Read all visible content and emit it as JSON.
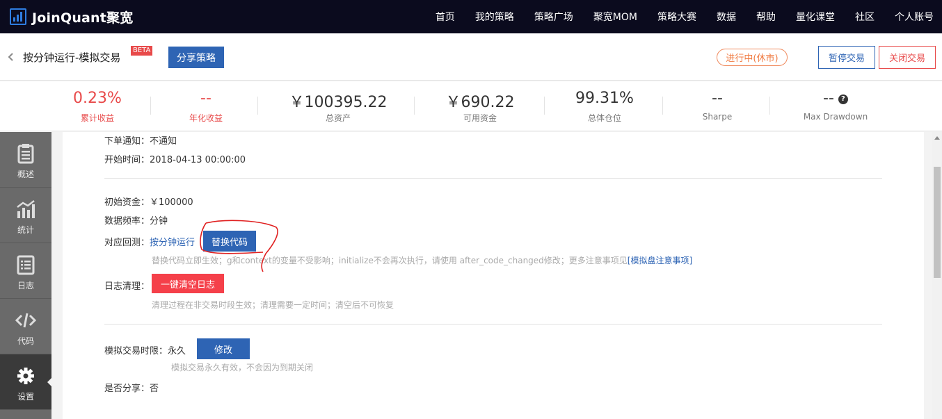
{
  "nav": {
    "brand": "JoinQuant聚宽",
    "items": [
      "首页",
      "我的策略",
      "策略广场",
      "聚宽MOM",
      "策略大赛",
      "数据",
      "帮助",
      "量化课堂",
      "社区",
      "个人账号"
    ]
  },
  "header": {
    "title": "按分钟运行-模拟交易",
    "beta": "BETA",
    "share_label": "分享策略",
    "status": "进行中(休市)",
    "pause_label": "暂停交易",
    "close_label": "关闭交易"
  },
  "stats": [
    {
      "value": "0.23%",
      "label": "累计收益",
      "color": "#e84a4a"
    },
    {
      "value": "--",
      "label": "年化收益",
      "color": "#e84a4a"
    },
    {
      "value": "￥100395.22",
      "label": "总资产"
    },
    {
      "value": "￥690.22",
      "label": "可用资金"
    },
    {
      "value": "99.31%",
      "label": "总体仓位"
    },
    {
      "value": "--",
      "label": "Sharpe"
    },
    {
      "value": "--",
      "label": "Max Drawdown",
      "icon": "help-icon"
    }
  ],
  "sidebar": {
    "items": [
      {
        "label": "概述",
        "icon": "clipboard-icon"
      },
      {
        "label": "统计",
        "icon": "chart-icon"
      },
      {
        "label": "日志",
        "icon": "list-icon"
      },
      {
        "label": "代码",
        "icon": "code-icon"
      },
      {
        "label": "设置",
        "icon": "gear-icon",
        "active": true
      }
    ]
  },
  "settings": {
    "order_notice": "下单通知：不通知",
    "start_time": "开始时间：2018-04-13 00:00:00",
    "initial_capital": "初始资金：￥100000",
    "data_freq": "数据频率：分钟",
    "backtest_label": "对应回测：",
    "backtest_link": "按分钟运行",
    "replace_code_label": "替换代码",
    "replace_hint": "替换代码立即生效；g和context的变量不受影响；initialize不会再次执行，请使用 after_code_changed修改；更多注意事项见",
    "replace_hint_link": "[模拟盘注意事项]",
    "log_clear_label": "日志清理：",
    "log_clear_button": "一键清空日志",
    "log_clear_hint": "清理过程在非交易时段生效；清理需要一定时间；清空后不可恢复",
    "time_limit": "模拟交易时限：永久",
    "modify_label": "修改",
    "time_limit_hint": "模拟交易永久有效，不会因为到期关闭",
    "share_status": "是否分享：否"
  }
}
